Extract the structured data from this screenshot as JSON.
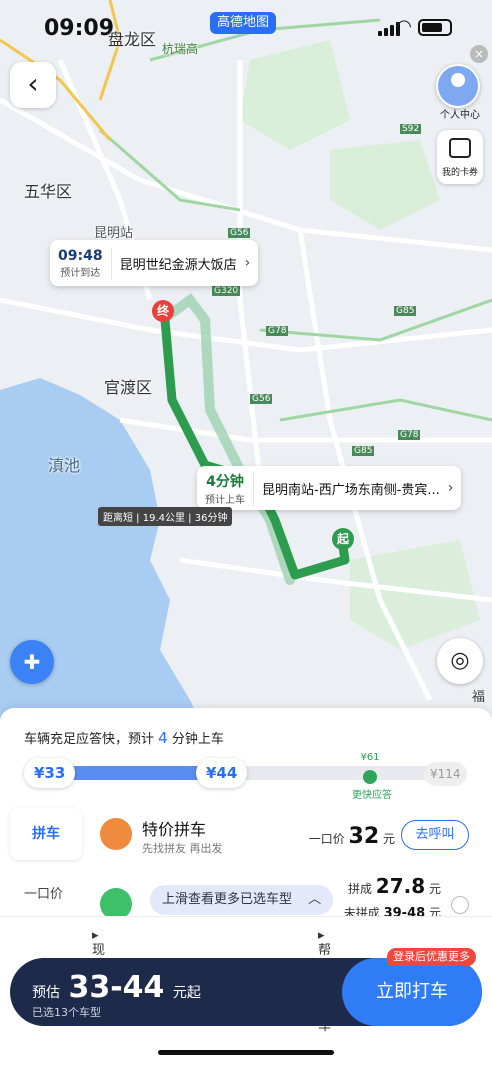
{
  "status": {
    "time": "09:09",
    "amap_label": "高德地图"
  },
  "map": {
    "labels": {
      "panlong": "盘龙区",
      "hangrui": "杭瑞高",
      "wuhua": "五华区",
      "kunming": "昆明站",
      "guandu": "官渡区",
      "dianchi": "滇池",
      "fu": "福"
    },
    "roads": {
      "g56a": "G56",
      "g320": "G320",
      "g78a": "G78",
      "g56b": "G56",
      "g85a": "G85",
      "g78b": "G78",
      "g85b": "G85",
      "s92": "S92"
    },
    "dest_popup": {
      "time": "09:48",
      "sub": "预计到达",
      "name": "昆明世纪金源大饭店"
    },
    "pickup_popup": {
      "time": "4分钟",
      "sub": "预计上车",
      "name": "昆明南站-西广场东南侧-贵宾..."
    },
    "distance": "距离短 | 19.4公里 | 36分钟",
    "end_pin": "终",
    "start_pin": "起",
    "personal_center": "个人中心",
    "coupon": "我的卡券"
  },
  "panel": {
    "eta_prefix": "车辆充足应答快，预计",
    "eta_num": "4",
    "eta_suffix": "分钟上车",
    "price_low": "¥33",
    "price_mid": "¥44",
    "price_high": "¥114",
    "fast_price": "¥61",
    "fast_label": "更快应答",
    "tab_carpool": "拼车",
    "tab_fixed": "一口价",
    "row1": {
      "name": "特价拼车",
      "sub": "先找拼友 再出发",
      "price_prefix": "一口价",
      "price": "32",
      "unit": "元",
      "button": "去呼叫"
    },
    "row2": {
      "price_prefix": "拼成",
      "price": "27.8",
      "unit": "元",
      "sub_prefix": "未拼成",
      "sub_price": "39-48",
      "sub_unit": "元"
    },
    "more_hint": "上滑查看更多已选车型",
    "now": "现在",
    "help_call": "帮他人叫车",
    "estimate_prefix": "预估",
    "estimate": "33-44",
    "estimate_suffix": "元起",
    "selected": "已选13个车型",
    "cta": "立即打车",
    "promo": "登录后优惠更多"
  },
  "colors": {
    "route": "#2e9c4e",
    "accent": "#2b6ef6",
    "cta_bg": "#1e2a4a"
  }
}
